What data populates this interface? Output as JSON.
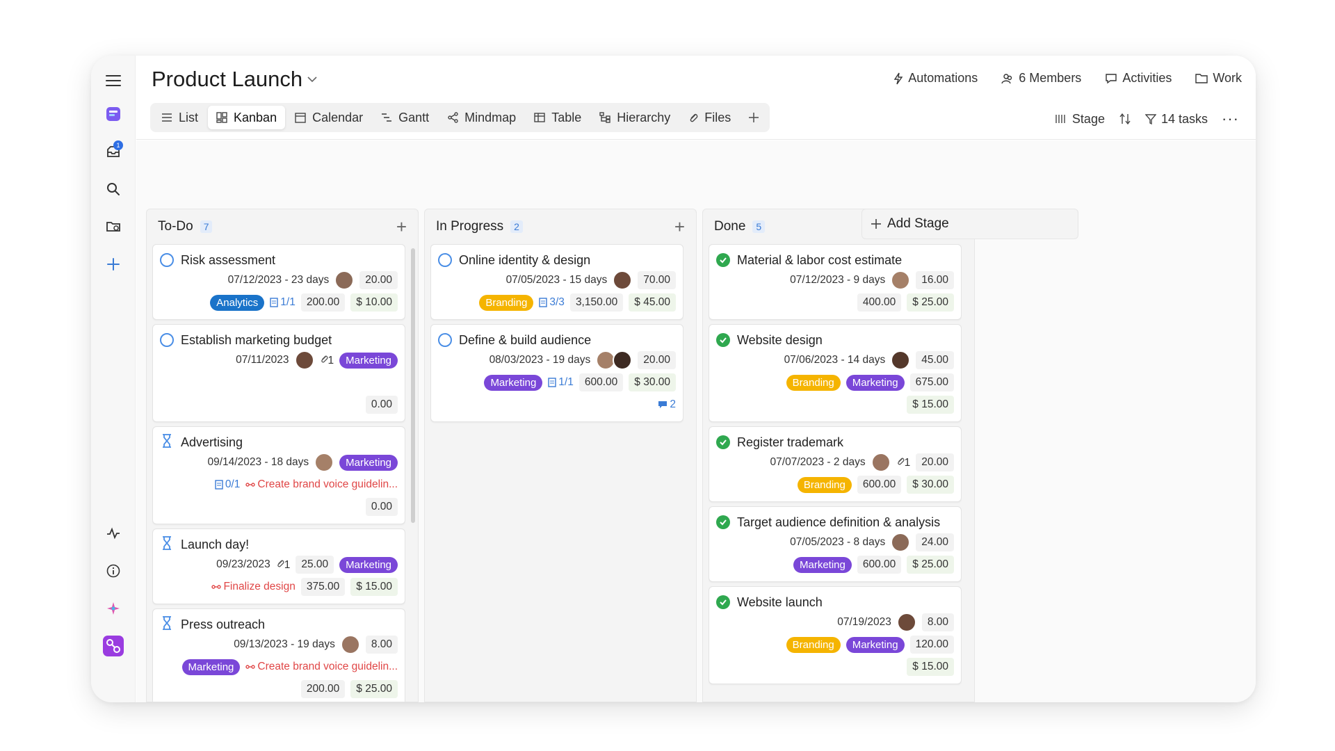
{
  "project": {
    "title": "Product Launch"
  },
  "header": {
    "actions": [
      {
        "label": "Automations",
        "icon": "bolt-icon"
      },
      {
        "label": "6 Members",
        "icon": "members-icon"
      },
      {
        "label": "Activities",
        "icon": "chat-icon"
      },
      {
        "label": "Work",
        "icon": "folder-icon"
      }
    ]
  },
  "views": [
    {
      "label": "List",
      "icon": "list-icon"
    },
    {
      "label": "Kanban",
      "icon": "kanban-icon",
      "active": true
    },
    {
      "label": "Calendar",
      "icon": "calendar-icon"
    },
    {
      "label": "Gantt",
      "icon": "gantt-icon"
    },
    {
      "label": "Mindmap",
      "icon": "mindmap-icon"
    },
    {
      "label": "Table",
      "icon": "table-icon"
    },
    {
      "label": "Hierarchy",
      "icon": "hierarchy-icon"
    },
    {
      "label": "Files",
      "icon": "paperclip-icon"
    }
  ],
  "tools": {
    "group_label": "Stage",
    "filter_label": "14 tasks"
  },
  "rail": {
    "inbox_badge": "1"
  },
  "colors": {
    "branding": "#f5b400",
    "marketing": "#7a47d8",
    "analytics": "#1a73c9",
    "done": "#2fa84f",
    "accent": "#3a7bd5"
  },
  "columns": [
    {
      "name": "To-Do",
      "count": "7",
      "cards": [
        {
          "title": "Risk assessment",
          "status": "open",
          "date": "07/12/2023 - 23 days",
          "avatar": true,
          "num": "20.00",
          "tags": [
            "Analytics"
          ],
          "sub": "1/1",
          "amount": "200.00",
          "money": "$ 10.00"
        },
        {
          "title": "Establish marketing budget",
          "status": "open",
          "date": "07/11/2023",
          "avatar": true,
          "attach": "1",
          "tags": [
            "Marketing"
          ],
          "amount": "0.00"
        },
        {
          "title": "Advertising",
          "status": "waiting",
          "date": "09/14/2023 - 18 days",
          "avatar": true,
          "tags": [
            "Marketing"
          ],
          "sub": "0/1",
          "link": "Create brand voice guidelin...",
          "amount": "0.00"
        },
        {
          "title": "Launch day!",
          "status": "waiting",
          "date": "09/23/2023",
          "attach": "1",
          "num": "25.00",
          "tags": [
            "Marketing"
          ],
          "link": "Finalize design",
          "amount": "375.00",
          "money": "$ 15.00"
        },
        {
          "title": "Press outreach",
          "status": "waiting",
          "date": "09/13/2023 - 19 days",
          "avatar": true,
          "num": "8.00",
          "tags": [
            "Marketing"
          ],
          "link": "Create brand voice guidelin...",
          "amount": "200.00",
          "money": "$ 25.00"
        }
      ]
    },
    {
      "name": "In Progress",
      "count": "2",
      "cards": [
        {
          "title": "Online identity & design",
          "status": "open",
          "date": "07/05/2023 - 15 days",
          "avatar": true,
          "num": "70.00",
          "tags": [
            "Branding"
          ],
          "sub": "3/3",
          "amount": "3,150.00",
          "money": "$ 45.00"
        },
        {
          "title": "Define & build audience",
          "status": "open",
          "date": "08/03/2023 - 19 days",
          "avatar": true,
          "avatar2": true,
          "num": "20.00",
          "tags": [
            "Marketing"
          ],
          "sub": "1/1",
          "amount": "600.00",
          "money": "$ 30.00",
          "comments": "2"
        }
      ]
    },
    {
      "name": "Done",
      "count": "5",
      "cards": [
        {
          "title": "Material & labor cost estimate",
          "status": "done",
          "date": "07/12/2023 - 9 days",
          "avatar": true,
          "num": "16.00",
          "amount": "400.00",
          "money": "$ 25.00"
        },
        {
          "title": "Website design",
          "status": "done",
          "date": "07/06/2023 - 14 days",
          "avatar": true,
          "num": "45.00",
          "tags": [
            "Branding",
            "Marketing"
          ],
          "amount": "675.00",
          "money": "$ 15.00"
        },
        {
          "title": "Register trademark",
          "status": "done",
          "date": "07/07/2023 - 2 days",
          "avatar": true,
          "attach": "1",
          "num": "20.00",
          "tags": [
            "Branding"
          ],
          "amount": "600.00",
          "money": "$ 30.00"
        },
        {
          "title": "Target audience definition & analysis",
          "status": "done",
          "date": "07/05/2023 - 8 days",
          "avatar": true,
          "num": "24.00",
          "tags": [
            "Marketing"
          ],
          "amount": "600.00",
          "money": "$ 25.00"
        },
        {
          "title": "Website launch",
          "status": "done",
          "date": "07/19/2023",
          "avatar": true,
          "num": "8.00",
          "tags": [
            "Branding",
            "Marketing"
          ],
          "amount": "120.00",
          "money": "$ 15.00"
        }
      ]
    }
  ],
  "add_stage_label": "Add Stage"
}
